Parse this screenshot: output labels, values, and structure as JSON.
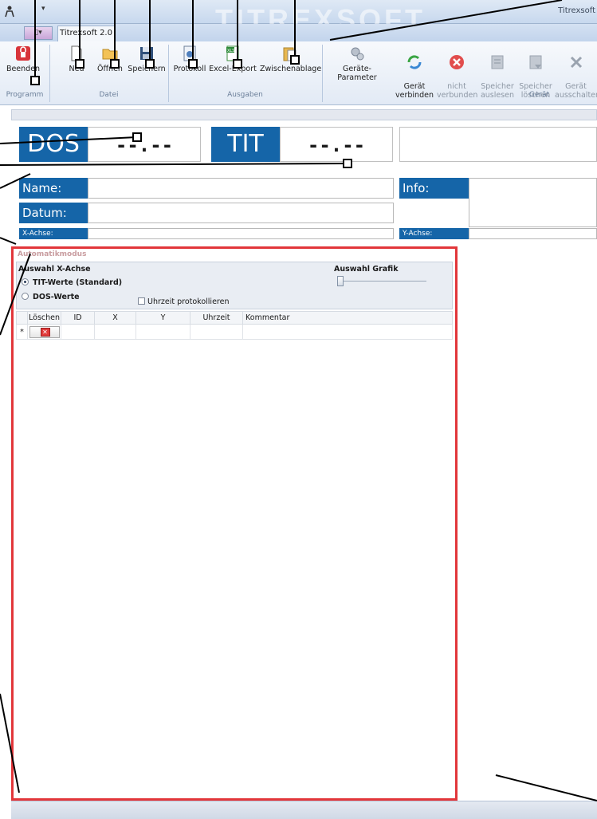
{
  "window": {
    "title": "Titrexsoft",
    "watermark": "TITREXSOFT",
    "qa_dropdown": "▾"
  },
  "ribbon": {
    "file_tab": "▯▾",
    "active_tab": "Titrexsoft 2.0",
    "buttons": {
      "beenden": "Beenden",
      "neu": "Neu",
      "oeffnen": "Öffnen",
      "speichern": "Speichern",
      "protokoll": "Protokoll",
      "excel_export": "Excel-Export",
      "zwischenablage": "Zwischenablage",
      "geraete_parameter": "Geräte-Parameter",
      "geraet_verbinden": "Gerät\nverbinden",
      "nicht_verbunden": "nicht\nverbunden",
      "speicher_auslesen": "Speicher\nauslesen",
      "speicher_loeschen": "Speicher\nlöschen",
      "geraet_ausschalten": "Gerät\nausschalten"
    },
    "groups": {
      "programm": "Programm",
      "datei": "Datei",
      "ausgaben": "Ausgaben",
      "geraet": "Gerät"
    }
  },
  "display": {
    "dos_label": "DOS",
    "dos_value": "--.--",
    "tit_label": "TIT",
    "tit_value": "--.--"
  },
  "meta": {
    "name_label": "Name:",
    "datum_label": "Datum:",
    "x_achse_label": "X-Achse:",
    "info_label": "Info:",
    "y_achse_label": "Y-Achse:"
  },
  "auto_mode": {
    "title": "Automatikmodus",
    "x_axis_heading": "Auswahl X-Achse",
    "option_tit": "TIT-Werte (Standard)",
    "option_dos": "DOS-Werte",
    "log_time_checkbox": "Uhrzeit protokollieren",
    "graphic_heading": "Auswahl Grafik",
    "grid_columns": [
      "Löschen",
      "ID",
      "X",
      "Y",
      "Uhrzeit",
      "Kommentar"
    ],
    "new_row_marker": "*",
    "delete_glyph": "✕"
  },
  "colors": {
    "display_blue": "#1565a8",
    "panel_border_red": "#e2363a"
  }
}
